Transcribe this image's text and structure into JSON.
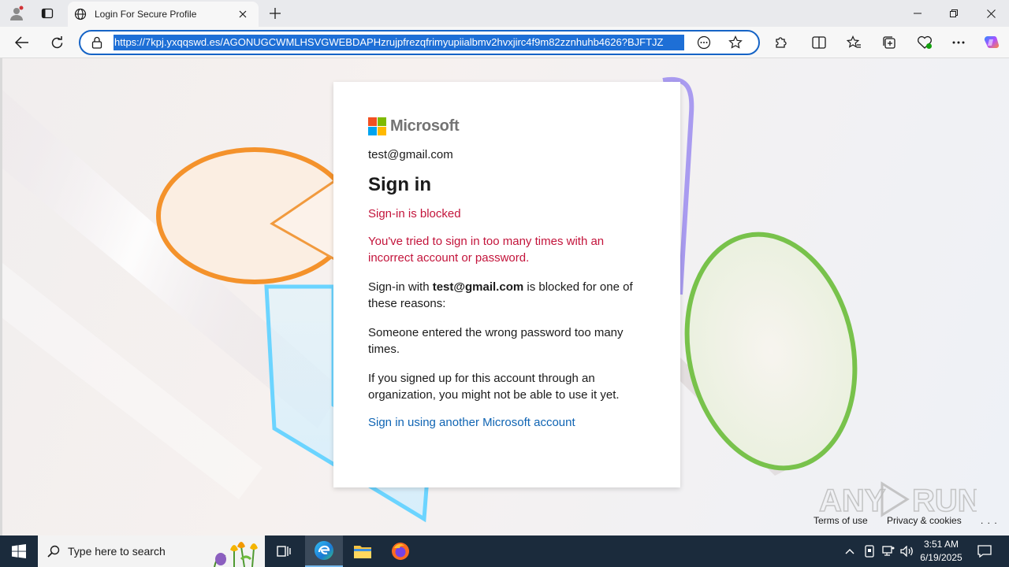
{
  "browser": {
    "tab_title": "Login For Secure Profile",
    "url": "https://7kpj.yxqqswd.es/AGONUGCWMLHSVGWEBDAPHzrujpfrezqfrimyupiialbmv2hvxjirc4f9m82zznhuhb4626?BJFTJZ"
  },
  "card": {
    "brand": "Microsoft",
    "identity": "test@gmail.com",
    "title": "Sign in",
    "error_heading": "Sign-in is blocked",
    "error_body": "You've tried to sign in too many times with an incorrect account or password.",
    "blocked_prefix": "Sign-in with ",
    "blocked_email": "test@gmail.com",
    "blocked_suffix": " is blocked for one of these reasons:",
    "reason_1": "Someone entered the wrong password too many times.",
    "reason_2": "If you signed up for this account through an organization, you might not be able to use it yet.",
    "alt_account_link": "Sign in using another Microsoft account"
  },
  "footer": {
    "terms": "Terms of use",
    "privacy": "Privacy & cookies",
    "more": ". . ."
  },
  "taskbar": {
    "search_placeholder": "Type here to search",
    "time": "3:51 AM",
    "date": "6/19/2025"
  },
  "watermark": "ANY.RUN",
  "colors": {
    "error": "#c3143b",
    "link": "#0f64b3",
    "accent": "#1e6fd6",
    "ms_red": "#f25022",
    "ms_green": "#7fba00",
    "ms_blue": "#00a4ef",
    "ms_yellow": "#ffb900"
  }
}
